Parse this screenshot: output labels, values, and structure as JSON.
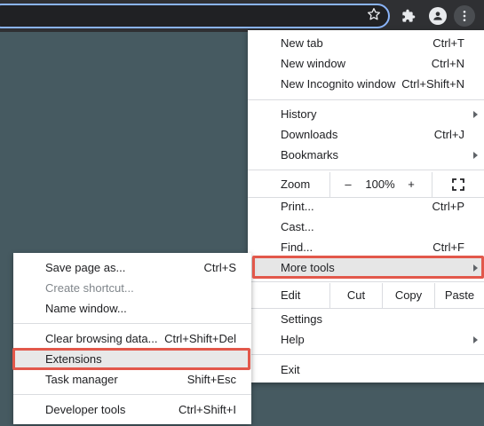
{
  "toolbar": {
    "icons": {
      "bookmark": "star-icon",
      "extensions": "puzzle-icon",
      "profile": "person-icon",
      "menu": "kebab-menu-icon"
    }
  },
  "main_menu": {
    "items": {
      "new_tab": {
        "label": "New tab",
        "shortcut": "Ctrl+T"
      },
      "new_window": {
        "label": "New window",
        "shortcut": "Ctrl+N"
      },
      "new_incognito": {
        "label": "New Incognito window",
        "shortcut": "Ctrl+Shift+N"
      },
      "history": {
        "label": "History"
      },
      "downloads": {
        "label": "Downloads",
        "shortcut": "Ctrl+J"
      },
      "bookmarks": {
        "label": "Bookmarks"
      },
      "print": {
        "label": "Print...",
        "shortcut": "Ctrl+P"
      },
      "cast": {
        "label": "Cast..."
      },
      "find": {
        "label": "Find...",
        "shortcut": "Ctrl+F"
      },
      "more_tools": {
        "label": "More tools"
      },
      "settings": {
        "label": "Settings"
      },
      "help": {
        "label": "Help"
      },
      "exit": {
        "label": "Exit"
      }
    },
    "zoom": {
      "label": "Zoom",
      "minus": "–",
      "value": "100%",
      "plus": "+"
    },
    "edit": {
      "label": "Edit",
      "cut": "Cut",
      "copy": "Copy",
      "paste": "Paste"
    }
  },
  "more_tools_menu": {
    "items": {
      "save_page": {
        "label": "Save page as...",
        "shortcut": "Ctrl+S"
      },
      "create_shortcut": {
        "label": "Create shortcut..."
      },
      "name_window": {
        "label": "Name window..."
      },
      "clear_browsing": {
        "label": "Clear browsing data...",
        "shortcut": "Ctrl+Shift+Del"
      },
      "extensions": {
        "label": "Extensions"
      },
      "task_manager": {
        "label": "Task manager",
        "shortcut": "Shift+Esc"
      },
      "developer_tools": {
        "label": "Developer tools",
        "shortcut": "Ctrl+Shift+I"
      }
    }
  },
  "colors": {
    "page_background": "#465a61",
    "toolbar": "#2f3033",
    "omnibox_focus_ring": "#8ab4f8",
    "highlight_annotation": "#e2584b"
  }
}
